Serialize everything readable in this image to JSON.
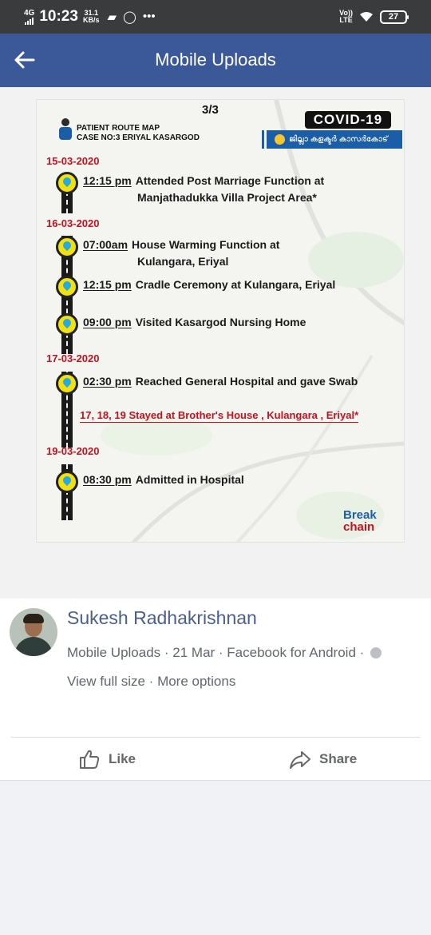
{
  "status_bar": {
    "network": "4G",
    "time": "10:23",
    "speed_value": "31.1",
    "speed_unit": "KB/s",
    "icons": [
      "game-icon",
      "whatsapp-icon",
      "more-icon"
    ],
    "volte_top": "Vo))",
    "volte_bottom": "LTE",
    "battery": "27"
  },
  "app_bar": {
    "title": "Mobile Uploads"
  },
  "photo": {
    "page": "3/3",
    "route_title_1": "PATIENT ROUTE MAP",
    "route_title_2": "CASE NO:3 ERIYAL KASARGOD",
    "covid_badge": "COVID-19",
    "collector_label": "ജില്ലാ കളക്ടർ കാസർകോട്",
    "dates": [
      "15-03-2020",
      "16-03-2020",
      "17-03-2020",
      "19-03-2020"
    ],
    "events": [
      {
        "time": "12:15 pm",
        "text": "Attended Post Marriage Function at",
        "text2": "Manjathadukka Villa Project Area*"
      },
      {
        "time": "07:00am",
        "text": "House Warming Function at",
        "text2": "Kulangara, Eriyal"
      },
      {
        "time": "12:15 pm",
        "text": "Cradle Ceremony at Kulangara, Eriyal"
      },
      {
        "time": "09:00 pm",
        "text": "Visited Kasargod Nursing Home"
      },
      {
        "time": "02:30 pm",
        "text": "Reached General Hospital and gave Swab"
      },
      {
        "time": "08:30 pm",
        "text": "Admitted in Hospital"
      }
    ],
    "stay_note": "17, 18, 19 Stayed at Brother's House , Kulangara , Eriyal*",
    "break_chain_1": "Break",
    "break_chain_2": "chain"
  },
  "post": {
    "author": "Sukesh Radhakrishnan",
    "meta": "Mobile Uploads · 21 Mar · Facebook for Android ·",
    "view_full_size": "View full size",
    "separator": " · ",
    "more_options": "More options",
    "like_label": "Like",
    "share_label": "Share"
  },
  "colors": {
    "app_bar": "#3b5998",
    "status_bar": "#3a3b3c",
    "author_name": "#4a5e8f",
    "poster_red": "#c1121f"
  }
}
